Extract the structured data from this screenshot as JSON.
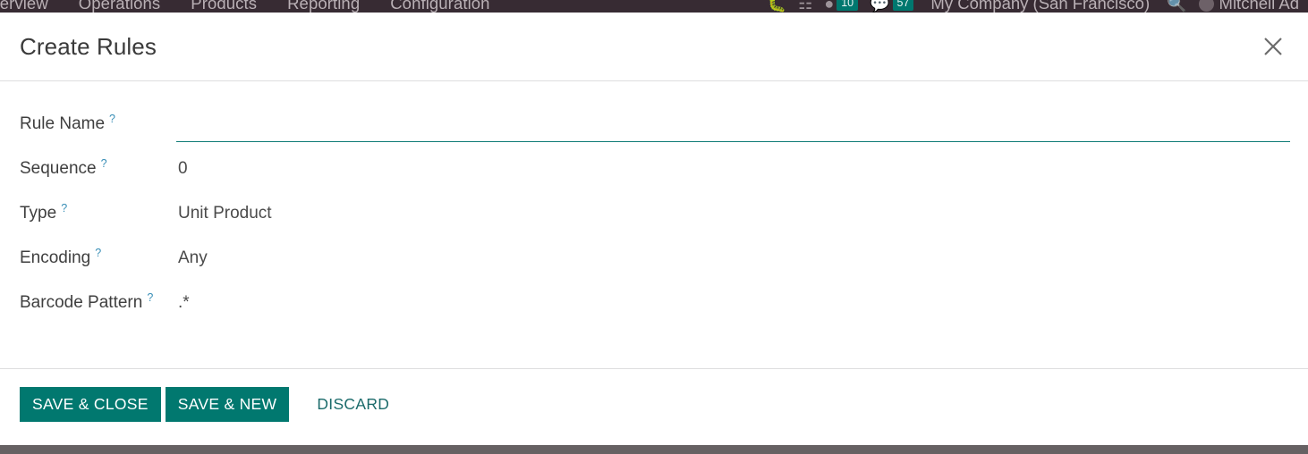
{
  "navbar": {
    "items": [
      {
        "label": "...erview"
      },
      {
        "label": "Operations"
      },
      {
        "label": "Products"
      },
      {
        "label": "Reporting"
      },
      {
        "label": "Configuration"
      }
    ],
    "icons": {
      "bug": "bug-icon",
      "grid": "grid-icon",
      "clock": "clock-icon",
      "chat": "chat-icon",
      "search": "search-icon"
    },
    "badges": [
      {
        "value": "10"
      },
      {
        "value": "57"
      }
    ],
    "company": "My Company (San Francisco)",
    "user": "Mitchell Ad"
  },
  "dialog": {
    "title": "Create Rules",
    "close_label": "✕",
    "fields": [
      {
        "label": "Rule Name",
        "help": "?",
        "type": "input",
        "value": "",
        "placeholder": ""
      },
      {
        "label": "Sequence",
        "help": "?",
        "type": "text",
        "value": "0"
      },
      {
        "label": "Type",
        "help": "?",
        "type": "text",
        "value": "Unit Product"
      },
      {
        "label": "Encoding",
        "help": "?",
        "type": "text",
        "value": "Any"
      },
      {
        "label": "Barcode Pattern",
        "help": "?",
        "type": "text",
        "value": ".*"
      }
    ],
    "footer": {
      "save_close_label": "SAVE & CLOSE",
      "save_new_label": "SAVE & NEW",
      "discard_label": "DISCARD"
    }
  },
  "colors": {
    "accent_teal": "#01786f",
    "navbar_bg": "#372b33",
    "help_blue": "#3a8fb7",
    "bottom_strip": "#666163"
  }
}
